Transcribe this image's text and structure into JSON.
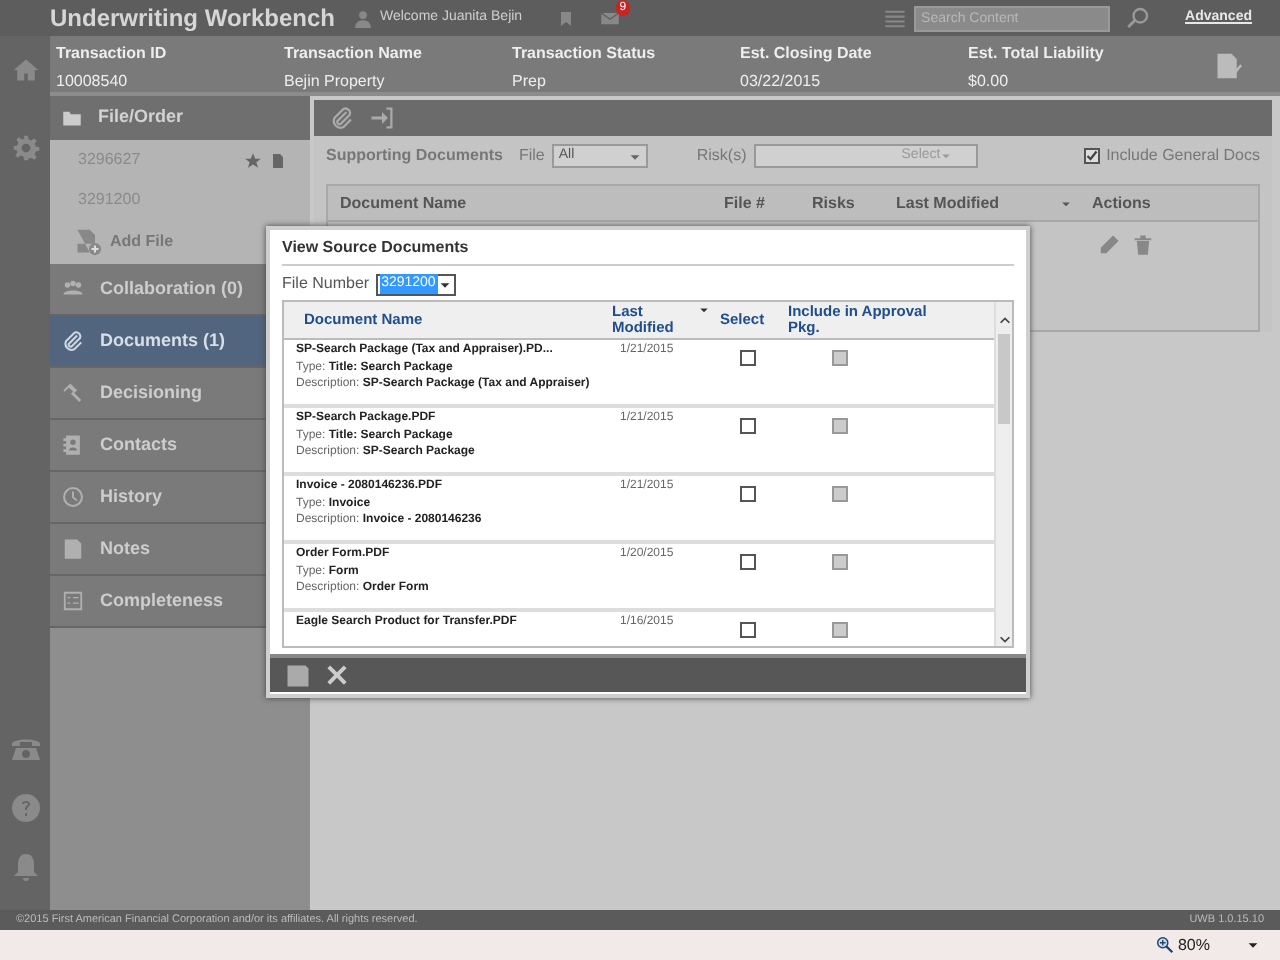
{
  "app": {
    "title": "Underwriting Workbench",
    "welcome": "Welcome Juanita Bejin",
    "mail_count": "9",
    "search": {
      "placeholder": "Search Content"
    },
    "advanced_link": "Advanced"
  },
  "transaction": {
    "columns": [
      {
        "label": "Transaction ID",
        "value": "10008540"
      },
      {
        "label": "Transaction Name",
        "value": "Bejin Property"
      },
      {
        "label": "Transaction Status",
        "value": "Prep"
      },
      {
        "label": "Est. Closing Date",
        "value": "03/22/2015"
      },
      {
        "label": "Est. Total Liability",
        "value": "$0.00"
      }
    ]
  },
  "sidebar": {
    "file_order": {
      "title": "File/Order",
      "files": [
        {
          "number": "3296627",
          "starred": true
        },
        {
          "number": "3291200",
          "starred": false
        }
      ],
      "add_file": "Add File"
    },
    "items": [
      {
        "label": "Collaboration (0)",
        "selected": false
      },
      {
        "label": "Documents (1)",
        "selected": true
      },
      {
        "label": "Decisioning",
        "selected": false
      },
      {
        "label": "Contacts",
        "selected": false
      },
      {
        "label": "History",
        "selected": false
      },
      {
        "label": "Notes",
        "selected": false
      },
      {
        "label": "Completeness",
        "selected": false
      }
    ]
  },
  "documents_panel": {
    "title": "Supporting Documents",
    "file_filter": {
      "label": "File",
      "value": "All"
    },
    "risks_filter": {
      "label": "Risk(s)",
      "placeholder": "Select"
    },
    "include_general_docs": {
      "label": "Include General Docs",
      "checked": true
    },
    "columns": [
      "Document Name",
      "File #",
      "Risks",
      "Last Modified",
      "Actions"
    ]
  },
  "modal": {
    "title": "View Source Documents",
    "file_number": {
      "label": "File Number",
      "value": "3291200"
    },
    "columns": [
      "Document Name",
      "Last Modified",
      "Select",
      "Include in Approval Pkg."
    ],
    "rows": [
      {
        "name": "SP-Search Package (Tax and Appraiser).PD...",
        "last_modified": "1/21/2015",
        "type_label": "Type:",
        "type": "Title: Search Package",
        "description_label": "Description:",
        "description": "SP-Search Package (Tax and Appraiser)",
        "selected": false,
        "include_disabled": true
      },
      {
        "name": "SP-Search Package.PDF",
        "last_modified": "1/21/2015",
        "type_label": "Type:",
        "type": "Title: Search Package",
        "description_label": "Description:",
        "description": "SP-Search Package",
        "selected": false,
        "include_disabled": true
      },
      {
        "name": "Invoice - 2080146236.PDF",
        "last_modified": "1/21/2015",
        "type_label": "Type:",
        "type": "Invoice",
        "description_label": "Description:",
        "description": "Invoice - 2080146236",
        "selected": false,
        "include_disabled": true
      },
      {
        "name": "Order Form.PDF",
        "last_modified": "1/20/2015",
        "type_label": "Type:",
        "type": "Form",
        "description_label": "Description:",
        "description": "Order Form",
        "selected": false,
        "include_disabled": true
      },
      {
        "name": "Eagle Search Product for Transfer.PDF",
        "last_modified": "1/16/2015",
        "selected": false,
        "include_disabled": true
      }
    ]
  },
  "footer": {
    "copyright": "©2015 First American Financial Corporation and/or its affiliates. All rights reserved.",
    "version": "UWB 1.0.15.10"
  },
  "status_bar": {
    "zoom": "80%"
  }
}
